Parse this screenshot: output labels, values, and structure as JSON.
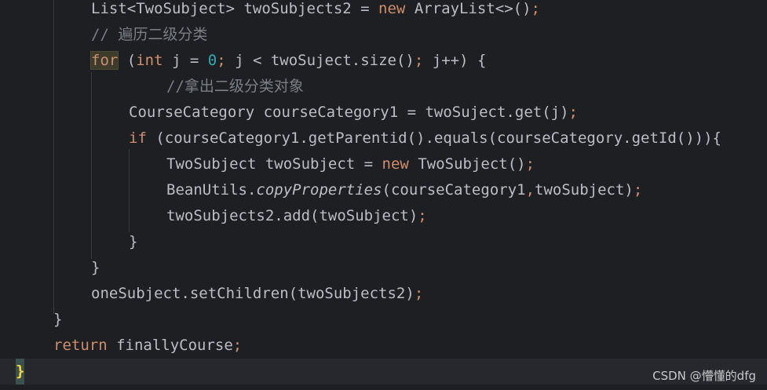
{
  "code_lines": [
    {
      "t1": "List<TwoSubject> twoSubjects2 = ",
      "kw": "new",
      "t2": " ArrayList<>()",
      "semi": ";"
    },
    {
      "comment": "// 遍历二级分类"
    },
    {
      "for_kw": "for",
      "t1": " (",
      "int_kw": "int",
      "t2": " j = ",
      "zero": "0",
      "s1": ";",
      "t3": " j < twoSuject.size()",
      "s2": ";",
      "t4": " j++) {"
    },
    {
      "comment": "//拿出二级分类对象"
    },
    {
      "t1": "CourseCategory courseCategory1 = twoSuject.get(j)",
      "semi": ";"
    },
    {
      "if_kw": "if",
      "t1": " (courseCategory1.getParentid().equals(courseCategory.getId())){"
    },
    {
      "t1": "TwoSubject twoSubject = ",
      "kw": "new",
      "t2": " TwoSubject()",
      "semi": ";"
    },
    {
      "t1": "BeanUtils.",
      "italic": "copyProperties",
      "t2": "(courseCategory1",
      "comma": ",",
      "t3": "twoSubject)",
      "semi": ";"
    },
    {
      "t1": "twoSubjects2.add(twoSubject)",
      "semi": ";"
    },
    {
      "t1": "}"
    },
    {
      "t1": "}"
    },
    {
      "t1": "oneSubject.setChildren(twoSubjects2)",
      "semi": ";"
    },
    {
      "t1": "}"
    },
    {
      "kw": "return",
      "t1": " finallyCourse",
      "semi": ";"
    },
    {
      "brace": "}"
    }
  ],
  "watermark": "CSDN @懵懂的dfg",
  "colors": {
    "background": "#1e1f22",
    "text": "#bcbec4",
    "keyword": "#cf8e6d",
    "number": "#2aacb8",
    "comment": "#7a7e85",
    "current_line": "#26282e"
  }
}
